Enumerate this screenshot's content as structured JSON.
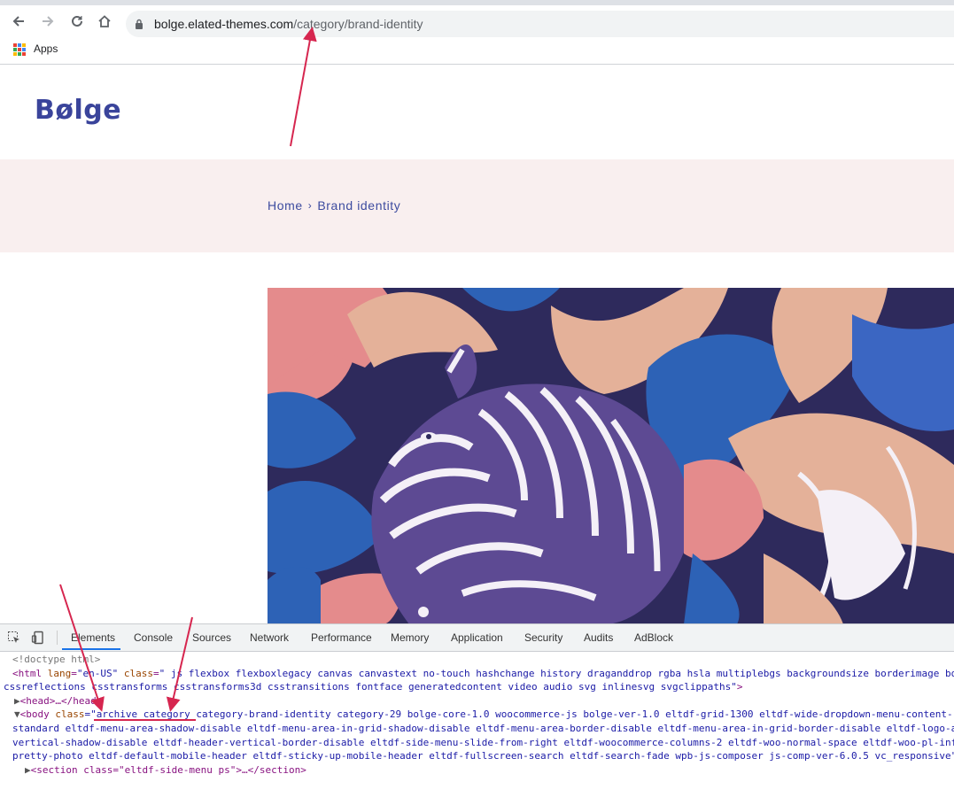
{
  "browser": {
    "url_host": "bolge.elated-themes.com",
    "url_path": "/category/brand-identity",
    "bookmarks_label": "Apps"
  },
  "site": {
    "logo": "Bølge",
    "breadcrumb_home": "Home",
    "breadcrumb_separator": "›",
    "breadcrumb_current": "Brand identity"
  },
  "devtools": {
    "tabs": [
      "Elements",
      "Console",
      "Sources",
      "Network",
      "Performance",
      "Memory",
      "Application",
      "Security",
      "Audits",
      "AdBlock"
    ],
    "lines": {
      "doctype": "<!doctype html>",
      "html_open": "<html",
      "html_lang_attr": "lang",
      "html_lang_val": "\"en-US\"",
      "html_class_attr": "class",
      "html_class_val_1": "\" js flexbox flexboxlegacy canvas canvastext no-touch hashchange history draganddrop rgba hsla multiplebgs backgroundsize borderimage bo",
      "html_class_val_2": "cssreflections csstransforms csstransforms3d csstransitions fontface generatedcontent video audio svg inlinesvg svgclippaths\"",
      "head": "<head>…</head>",
      "body_open": "<body",
      "body_class_attr": "class",
      "body_quote": "=\"",
      "body_class_highlight": "archive category",
      "body_class_val_1": " category-brand-identity category-29 bolge-core-1.0 woocommerce-js bolge-ver-1.0 eltdf-grid-1300 eltdf-wide-dropdown-menu-content-",
      "body_class_val_2": "standard eltdf-menu-area-shadow-disable eltdf-menu-area-in-grid-shadow-disable eltdf-menu-area-border-disable eltdf-menu-area-in-grid-border-disable eltdf-logo-a",
      "body_class_val_3": "vertical-shadow-disable eltdf-header-vertical-border-disable eltdf-side-menu-slide-from-right eltdf-woocommerce-columns-2 eltdf-woo-normal-space eltdf-woo-pl-inf",
      "body_class_val_4": "pretty-photo eltdf-default-mobile-header eltdf-sticky-up-mobile-header eltdf-fullscreen-search eltdf-search-fade wpb-js-composer js-comp-ver-6.0.5 vc_responsive\"",
      "section": "<section class=\"eltdf-side-menu ps\">…</section>"
    }
  },
  "colors": {
    "annotation": "#d6264f",
    "logo": "#3a449b",
    "breadcrumb_band": "#f9efef"
  }
}
